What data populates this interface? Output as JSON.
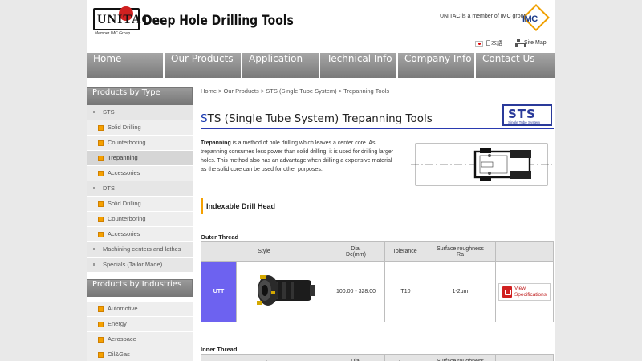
{
  "header": {
    "logo_text": "UNITAC",
    "logo_sub": "Member IMC Group",
    "brand": "Deep Hole Drilling Tools",
    "member_text": "UNITAC is a member of IMC group",
    "imc_logo": "IMC",
    "lang_label": "日本語",
    "sitemap_label": "Site Map"
  },
  "nav": [
    "Home",
    "Our Products",
    "Application",
    "Technical Info",
    "Company Info",
    "Contact Us"
  ],
  "sidebar": {
    "type_head": "Products by Type",
    "type_items": [
      {
        "label": "STS",
        "level": 1
      },
      {
        "label": "Solid Drilling",
        "level": 2
      },
      {
        "label": "Counterboring",
        "level": 2
      },
      {
        "label": "Trepanning",
        "level": 2,
        "selected": true
      },
      {
        "label": "Accessories",
        "level": 2
      },
      {
        "label": "DTS",
        "level": 1
      },
      {
        "label": "Solid Drilling",
        "level": 2
      },
      {
        "label": "Counterboring",
        "level": 2
      },
      {
        "label": "Accessories",
        "level": 2
      },
      {
        "label": "Machining centers and lathes",
        "level": 1
      },
      {
        "label": "Specials (Tailor Made)",
        "level": 1
      }
    ],
    "industry_head": "Products by Industries",
    "industry_items": [
      {
        "label": "Automotive",
        "level": 2
      },
      {
        "label": "Energy",
        "level": 2
      },
      {
        "label": "Aerospace",
        "level": 2
      },
      {
        "label": "Oil&Gas",
        "level": 2
      }
    ]
  },
  "main": {
    "breadcrumb": "Home > Our Products > STS (Single Tube System) > Trepanning Tools",
    "title_first": "S",
    "title_rest": "TS (Single Tube System) Trepanning Tools",
    "badge_title": "STS",
    "badge_sub": "Single Tube System",
    "desc_bold": "Trepanning",
    "desc_rest": " is a method of hole drilling which leaves a center core. As trepanning consumes less power than solid drilling, it is used for drilling larger holes. This method also has an advantage when drilling a expensive material as the solid core can be used for other purposes.",
    "section": "Indexable Drill Head",
    "outer_label": "Outer Thread",
    "inner_label": "Inner Thread",
    "columns": [
      "Style",
      "Dia.\nDc(mm)",
      "Tolerance",
      "Surface roughness\nRa",
      ""
    ],
    "col_style": "Style",
    "col_dia_1": "Dia.",
    "col_dia_2": "Dc(mm)",
    "col_tol": "Tolerance",
    "col_sr_1": "Surface roughness",
    "col_sr_2": "Ra",
    "row": {
      "code": "UTT",
      "dia": "100.00 - 328.00",
      "tolerance": "IT10",
      "roughness": "1-2μm",
      "spec_1": "View",
      "spec_2": "Specifications"
    }
  },
  "colors": {
    "accent_blue": "#2a3ab0",
    "orange": "#f5a000",
    "style_cell": "#6d62f0"
  }
}
